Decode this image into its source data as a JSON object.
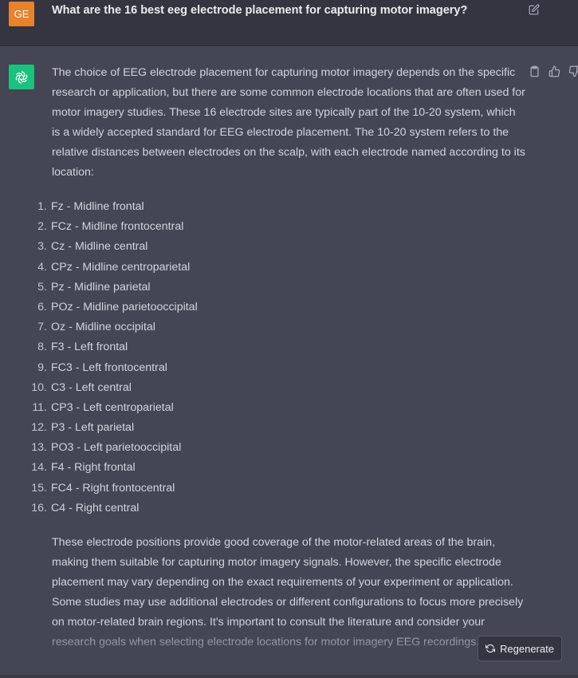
{
  "user_message": {
    "avatar_initials": "GE",
    "text": "What are the 16 best eeg electrode placement for capturing motor imagery?"
  },
  "assistant_message": {
    "intro": "The choice of EEG electrode placement for capturing motor imagery depends on the specific research or application, but there are some common electrode locations that are often used for motor imagery studies. These 16 electrode sites are typically part of the 10-20 system, which is a widely accepted standard for EEG electrode placement. The 10-20 system refers to the relative distances between electrodes on the scalp, with each electrode named according to its location:",
    "electrodes": [
      {
        "num": "1.",
        "text": "Fz - Midline frontal"
      },
      {
        "num": "2.",
        "text": "FCz - Midline frontocentral"
      },
      {
        "num": "3.",
        "text": "Cz - Midline central"
      },
      {
        "num": "4.",
        "text": "CPz - Midline centroparietal"
      },
      {
        "num": "5.",
        "text": "Pz - Midline parietal"
      },
      {
        "num": "6.",
        "text": "POz - Midline parietooccipital"
      },
      {
        "num": "7.",
        "text": "Oz - Midline occipital"
      },
      {
        "num": "8.",
        "text": "F3 - Left frontal"
      },
      {
        "num": "9.",
        "text": "FC3 - Left frontocentral"
      },
      {
        "num": "10.",
        "text": "C3 - Left central"
      },
      {
        "num": "11.",
        "text": "CP3 - Left centroparietal"
      },
      {
        "num": "12.",
        "text": "P3 - Left parietal"
      },
      {
        "num": "13.",
        "text": "PO3 - Left parietooccipital"
      },
      {
        "num": "14.",
        "text": "F4 - Right frontal"
      },
      {
        "num": "15.",
        "text": "FC4 - Right frontocentral"
      },
      {
        "num": "16.",
        "text": "C4 - Right central"
      }
    ],
    "closing": "These electrode positions provide good coverage of the motor-related areas of the brain, making them suitable for capturing motor imagery signals. However, the specific electrode placement may vary depending on the exact requirements of your experiment or application. Some studies may use additional electrodes or different configurations to focus more precisely on motor-related brain regions. It's important to consult the literature and consider your research goals when selecting electrode locations for motor imagery EEG recordings."
  },
  "regenerate_label": "Regenerate",
  "icons": {
    "edit": "edit-icon",
    "copy": "clipboard-icon",
    "like": "thumbs-up-icon",
    "dislike": "thumbs-down-icon",
    "assistant_logo": "openai-logo-icon",
    "regenerate": "refresh-icon"
  },
  "colors": {
    "user_avatar": "#e9822c",
    "assistant_avatar": "#19c37d",
    "user_background": "#343541",
    "assistant_background": "#444654"
  }
}
